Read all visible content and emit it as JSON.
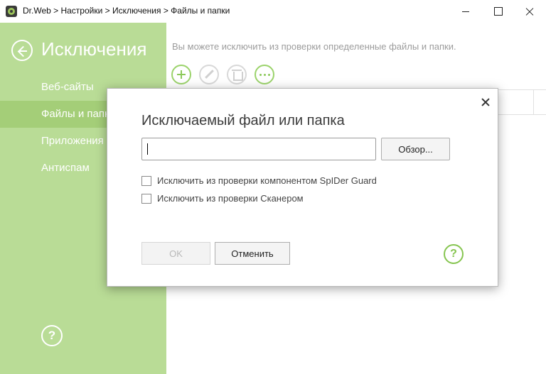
{
  "window": {
    "title": "Dr.Web > Настройки > Исключения > Файлы и папки",
    "icons": {
      "app": "drweb-spider-icon",
      "minimize": "minimize-icon",
      "maximize": "maximize-icon",
      "close": "close-icon"
    }
  },
  "sidebar": {
    "title": "Исключения",
    "items": [
      {
        "label": "Веб-сайты",
        "active": false
      },
      {
        "label": "Файлы и папки",
        "active": true
      },
      {
        "label": "Приложения",
        "active": false
      },
      {
        "label": "Антиспам",
        "active": false
      }
    ],
    "help_glyph": "?"
  },
  "main": {
    "description": "Вы можете исключить из проверки определенные файлы и папки.",
    "toolbar": [
      "add-icon",
      "edit-icon",
      "delete-icon",
      "more-icon"
    ]
  },
  "dialog": {
    "title": "Исключаемый файл или папка",
    "path_value": "",
    "browse_label": "Обзор...",
    "checkboxes": [
      {
        "label": "Исключить из проверки компонентом SpIDer Guard",
        "checked": false
      },
      {
        "label": "Исключить из проверки Сканером",
        "checked": false
      }
    ],
    "ok_label": "OK",
    "cancel_label": "Отменить",
    "help_glyph": "?"
  },
  "colors": {
    "sidebar_bg": "#b9dc96",
    "sidebar_active": "#a4ce78",
    "accent_green": "#86c550"
  }
}
